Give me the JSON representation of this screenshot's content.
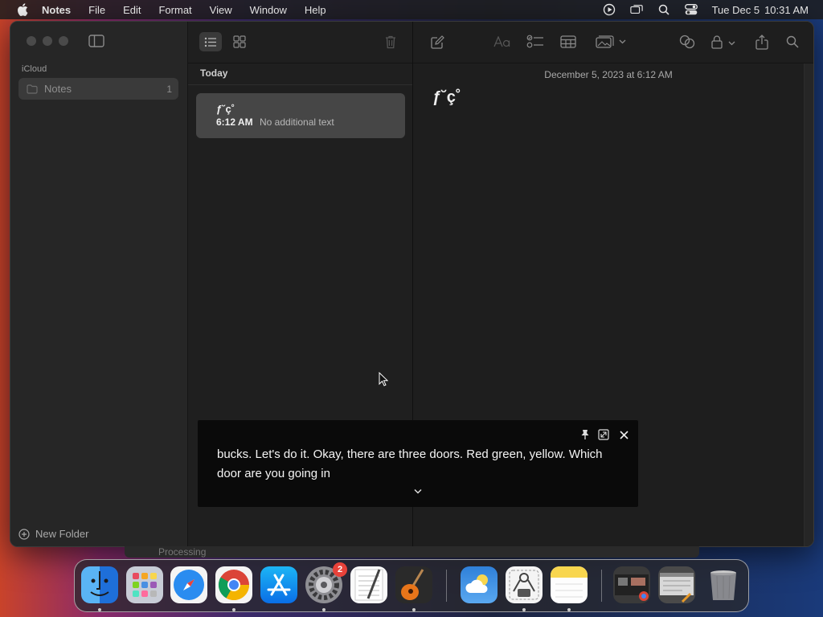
{
  "menubar": {
    "app_name": "Notes",
    "items": [
      "File",
      "Edit",
      "Format",
      "View",
      "Window",
      "Help"
    ],
    "date": "Tue Dec 5",
    "time": "10:31 AM",
    "status_icons": [
      "screen-recording-icon",
      "screen-mirroring-icon",
      "spotlight-icon",
      "control-center-icon"
    ]
  },
  "sidebar": {
    "section": "iCloud",
    "folders": [
      {
        "label": "Notes",
        "count": "1"
      }
    ],
    "new_folder": "New Folder"
  },
  "note_list": {
    "group": "Today",
    "notes": [
      {
        "title": "ƒ˘ç˚",
        "time": "6:12 AM",
        "preview": "No additional text"
      }
    ]
  },
  "editor": {
    "date": "December 5, 2023 at 6:12 AM",
    "body": "ƒ˘ç˚"
  },
  "caption": {
    "text": "bucks. Let's do it. Okay, there are three doors. Red green, yellow. Which door are you going in"
  },
  "behind_window": {
    "text": "Processing"
  },
  "dock": {
    "apps": [
      "Finder",
      "Launchpad",
      "Safari",
      "Chrome",
      "App Store",
      "System Settings",
      "TextEdit",
      "GarageBand",
      "Weather",
      "Screenshot",
      "Notes",
      "Recent 1",
      "Recent 2",
      "Trash"
    ],
    "settings_badge": "2"
  },
  "colors": {
    "accent": "#e8423a",
    "window_bg": "#1e1e1e",
    "sidebar_bg": "#262626"
  }
}
